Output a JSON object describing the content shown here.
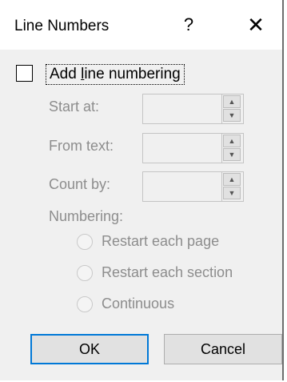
{
  "dialog": {
    "title": "Line Numbers",
    "help_label": "?",
    "close_label": "✕"
  },
  "options": {
    "add_line_numbering": {
      "label_pre": "Add ",
      "label_underlined": "l",
      "label_post": "ine numbering",
      "checked": false
    },
    "start_at": {
      "label": "Start at:",
      "value": ""
    },
    "from_text": {
      "label": "From text:",
      "value": ""
    },
    "count_by": {
      "label": "Count by:",
      "value": ""
    },
    "numbering": {
      "label": "Numbering:",
      "choices": [
        "Restart each page",
        "Restart each section",
        "Continuous"
      ]
    }
  },
  "buttons": {
    "ok": "OK",
    "cancel": "Cancel"
  },
  "spinner": {
    "up_glyph": "▲",
    "down_glyph": "▼"
  }
}
